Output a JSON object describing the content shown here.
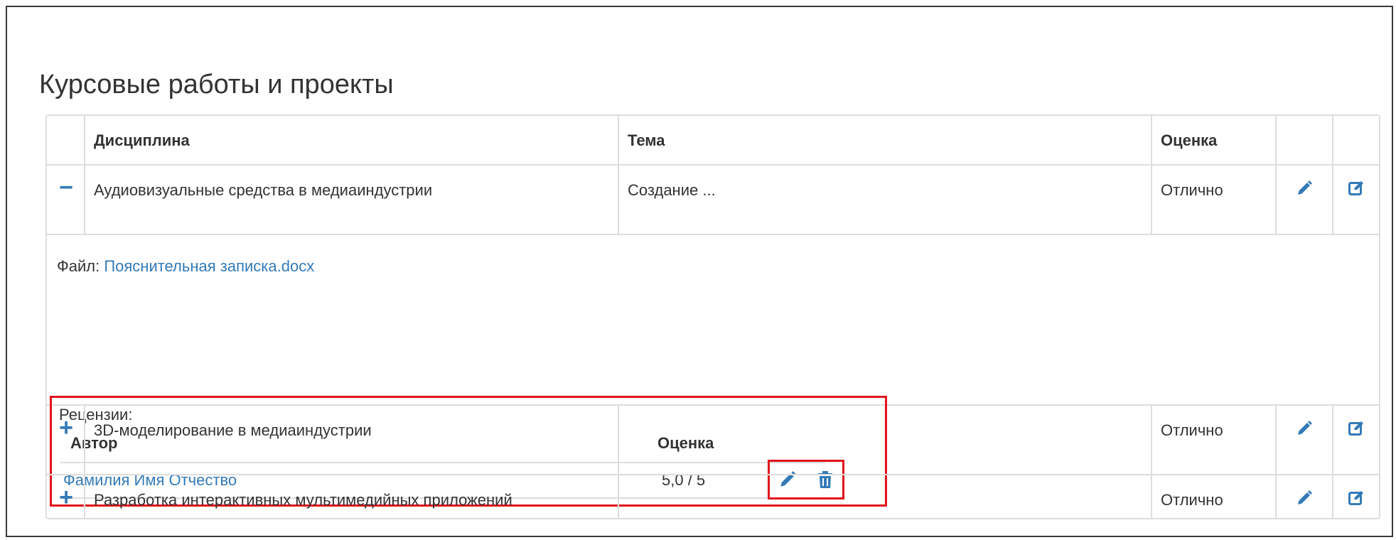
{
  "page_title": "Курсовые работы и проекты",
  "table": {
    "headers": {
      "discipline": "Дисциплина",
      "theme": "Тема",
      "grade": "Оценка"
    },
    "rows": [
      {
        "toggle": "−",
        "discipline": "Аудиовизуальные средства в медиаиндустрии",
        "theme": "Создание ...",
        "grade": "Отлично"
      },
      {
        "toggle": "+",
        "discipline": "3D-моделирование в медиаиндустрии",
        "theme": "",
        "grade": "Отлично"
      },
      {
        "toggle": "+",
        "discipline": "Разработка интерактивных мультимедийных приложений",
        "theme": "",
        "grade": "Отлично"
      }
    ],
    "row_icons": {
      "edit": "pencil-icon",
      "check": "edit-square-icon"
    }
  },
  "detail": {
    "file_label": "Файл:",
    "file_name": "Пояснительная записка.docx",
    "reviews": {
      "title": "Рецензии:",
      "headers": {
        "author": "Автор",
        "grade": "Оценка"
      },
      "items": [
        {
          "author": "Фамилия Имя Отчество",
          "score": "5,0 / 5"
        }
      ],
      "action_icons": [
        "pencil-icon",
        "trash-icon"
      ]
    }
  },
  "colors": {
    "link": "#337ab7",
    "highlight": "#e3131b",
    "border": "#dddddd",
    "text": "#333333"
  }
}
